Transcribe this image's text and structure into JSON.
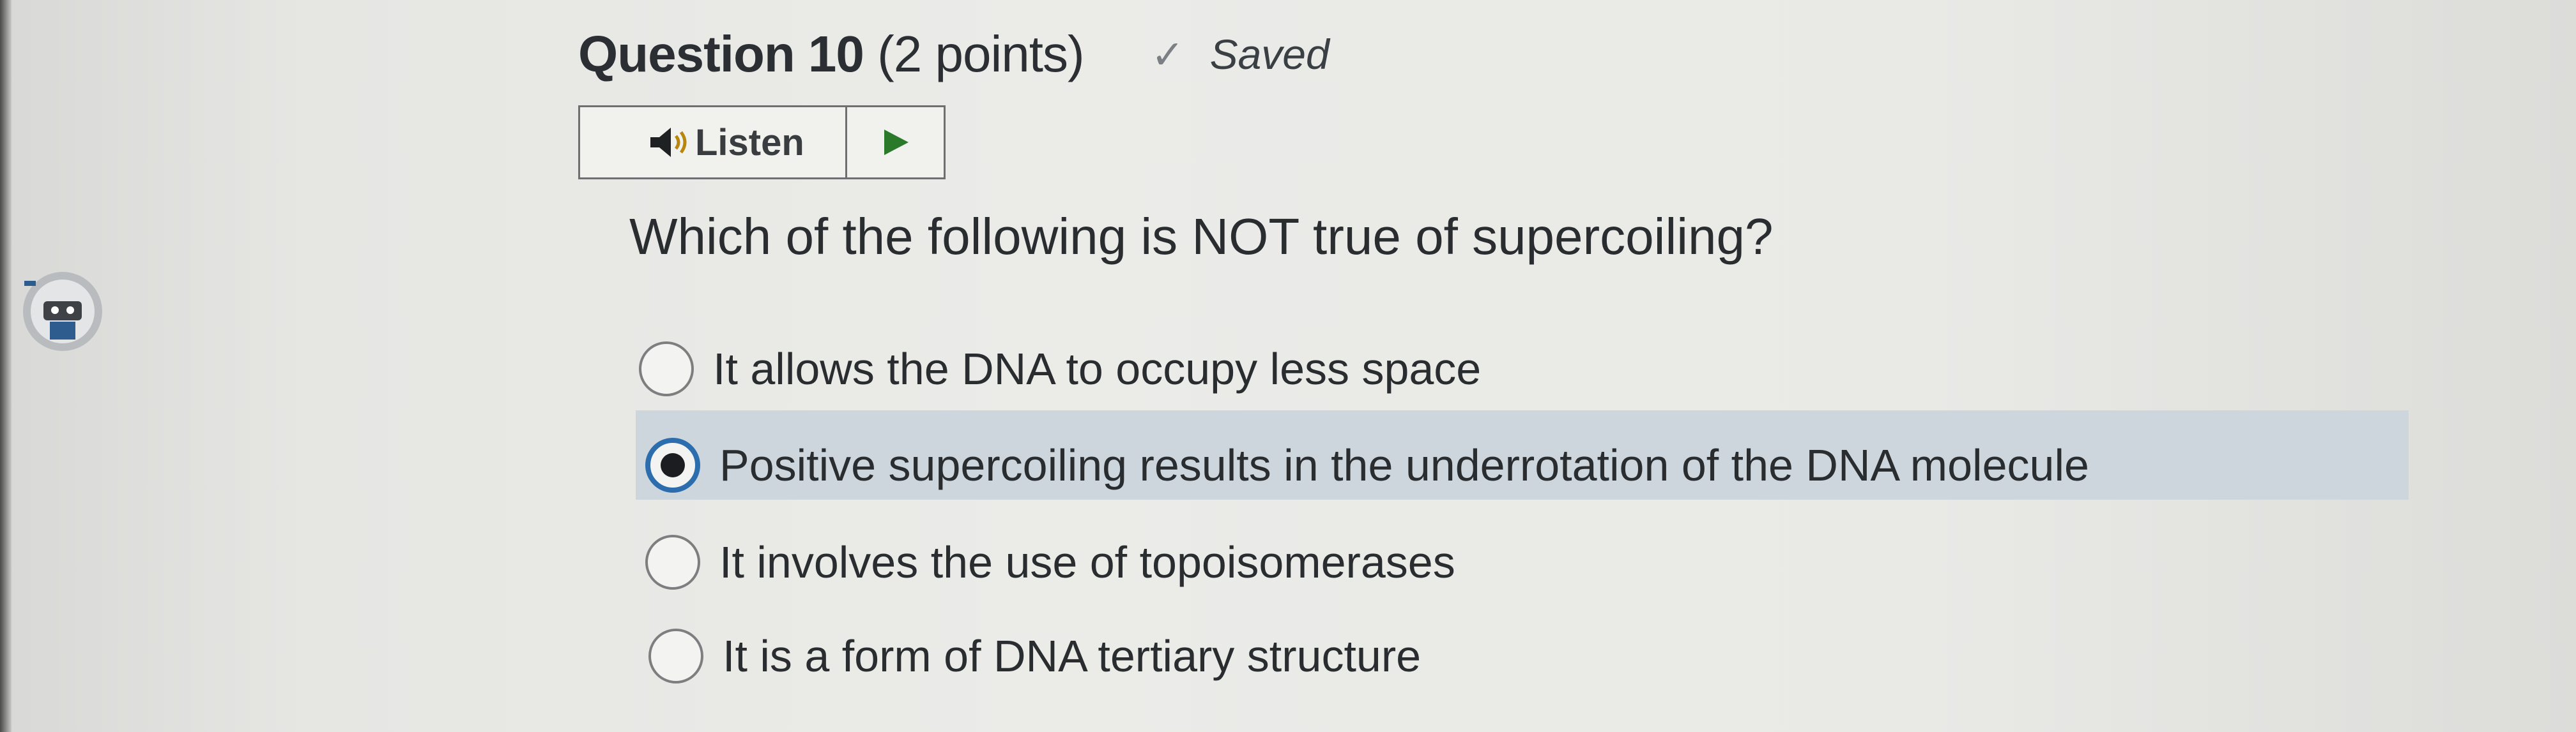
{
  "question": {
    "number_label": "Question 10",
    "points_label": "(2 points)",
    "saved_label": "Saved",
    "prompt": "Which of the following is NOT true of supercoiling?"
  },
  "listen": {
    "label": "Listen"
  },
  "options": [
    {
      "label": "It allows the DNA to occupy less space",
      "selected": false
    },
    {
      "label": "Positive supercoiling results in the underrotation of the DNA molecule",
      "selected": true
    },
    {
      "label": "It involves the use of topoisomerases",
      "selected": false
    },
    {
      "label": "It is a form of DNA tertiary structure",
      "selected": false
    }
  ],
  "icons": {
    "saved": "check-icon",
    "listen": "speaker-icon",
    "play": "play-icon",
    "avatar": "avatar-icon"
  },
  "colors": {
    "selected_row": "#cdd6dd",
    "radio_selected": "#2c6dae",
    "play": "#2a7a2a"
  }
}
